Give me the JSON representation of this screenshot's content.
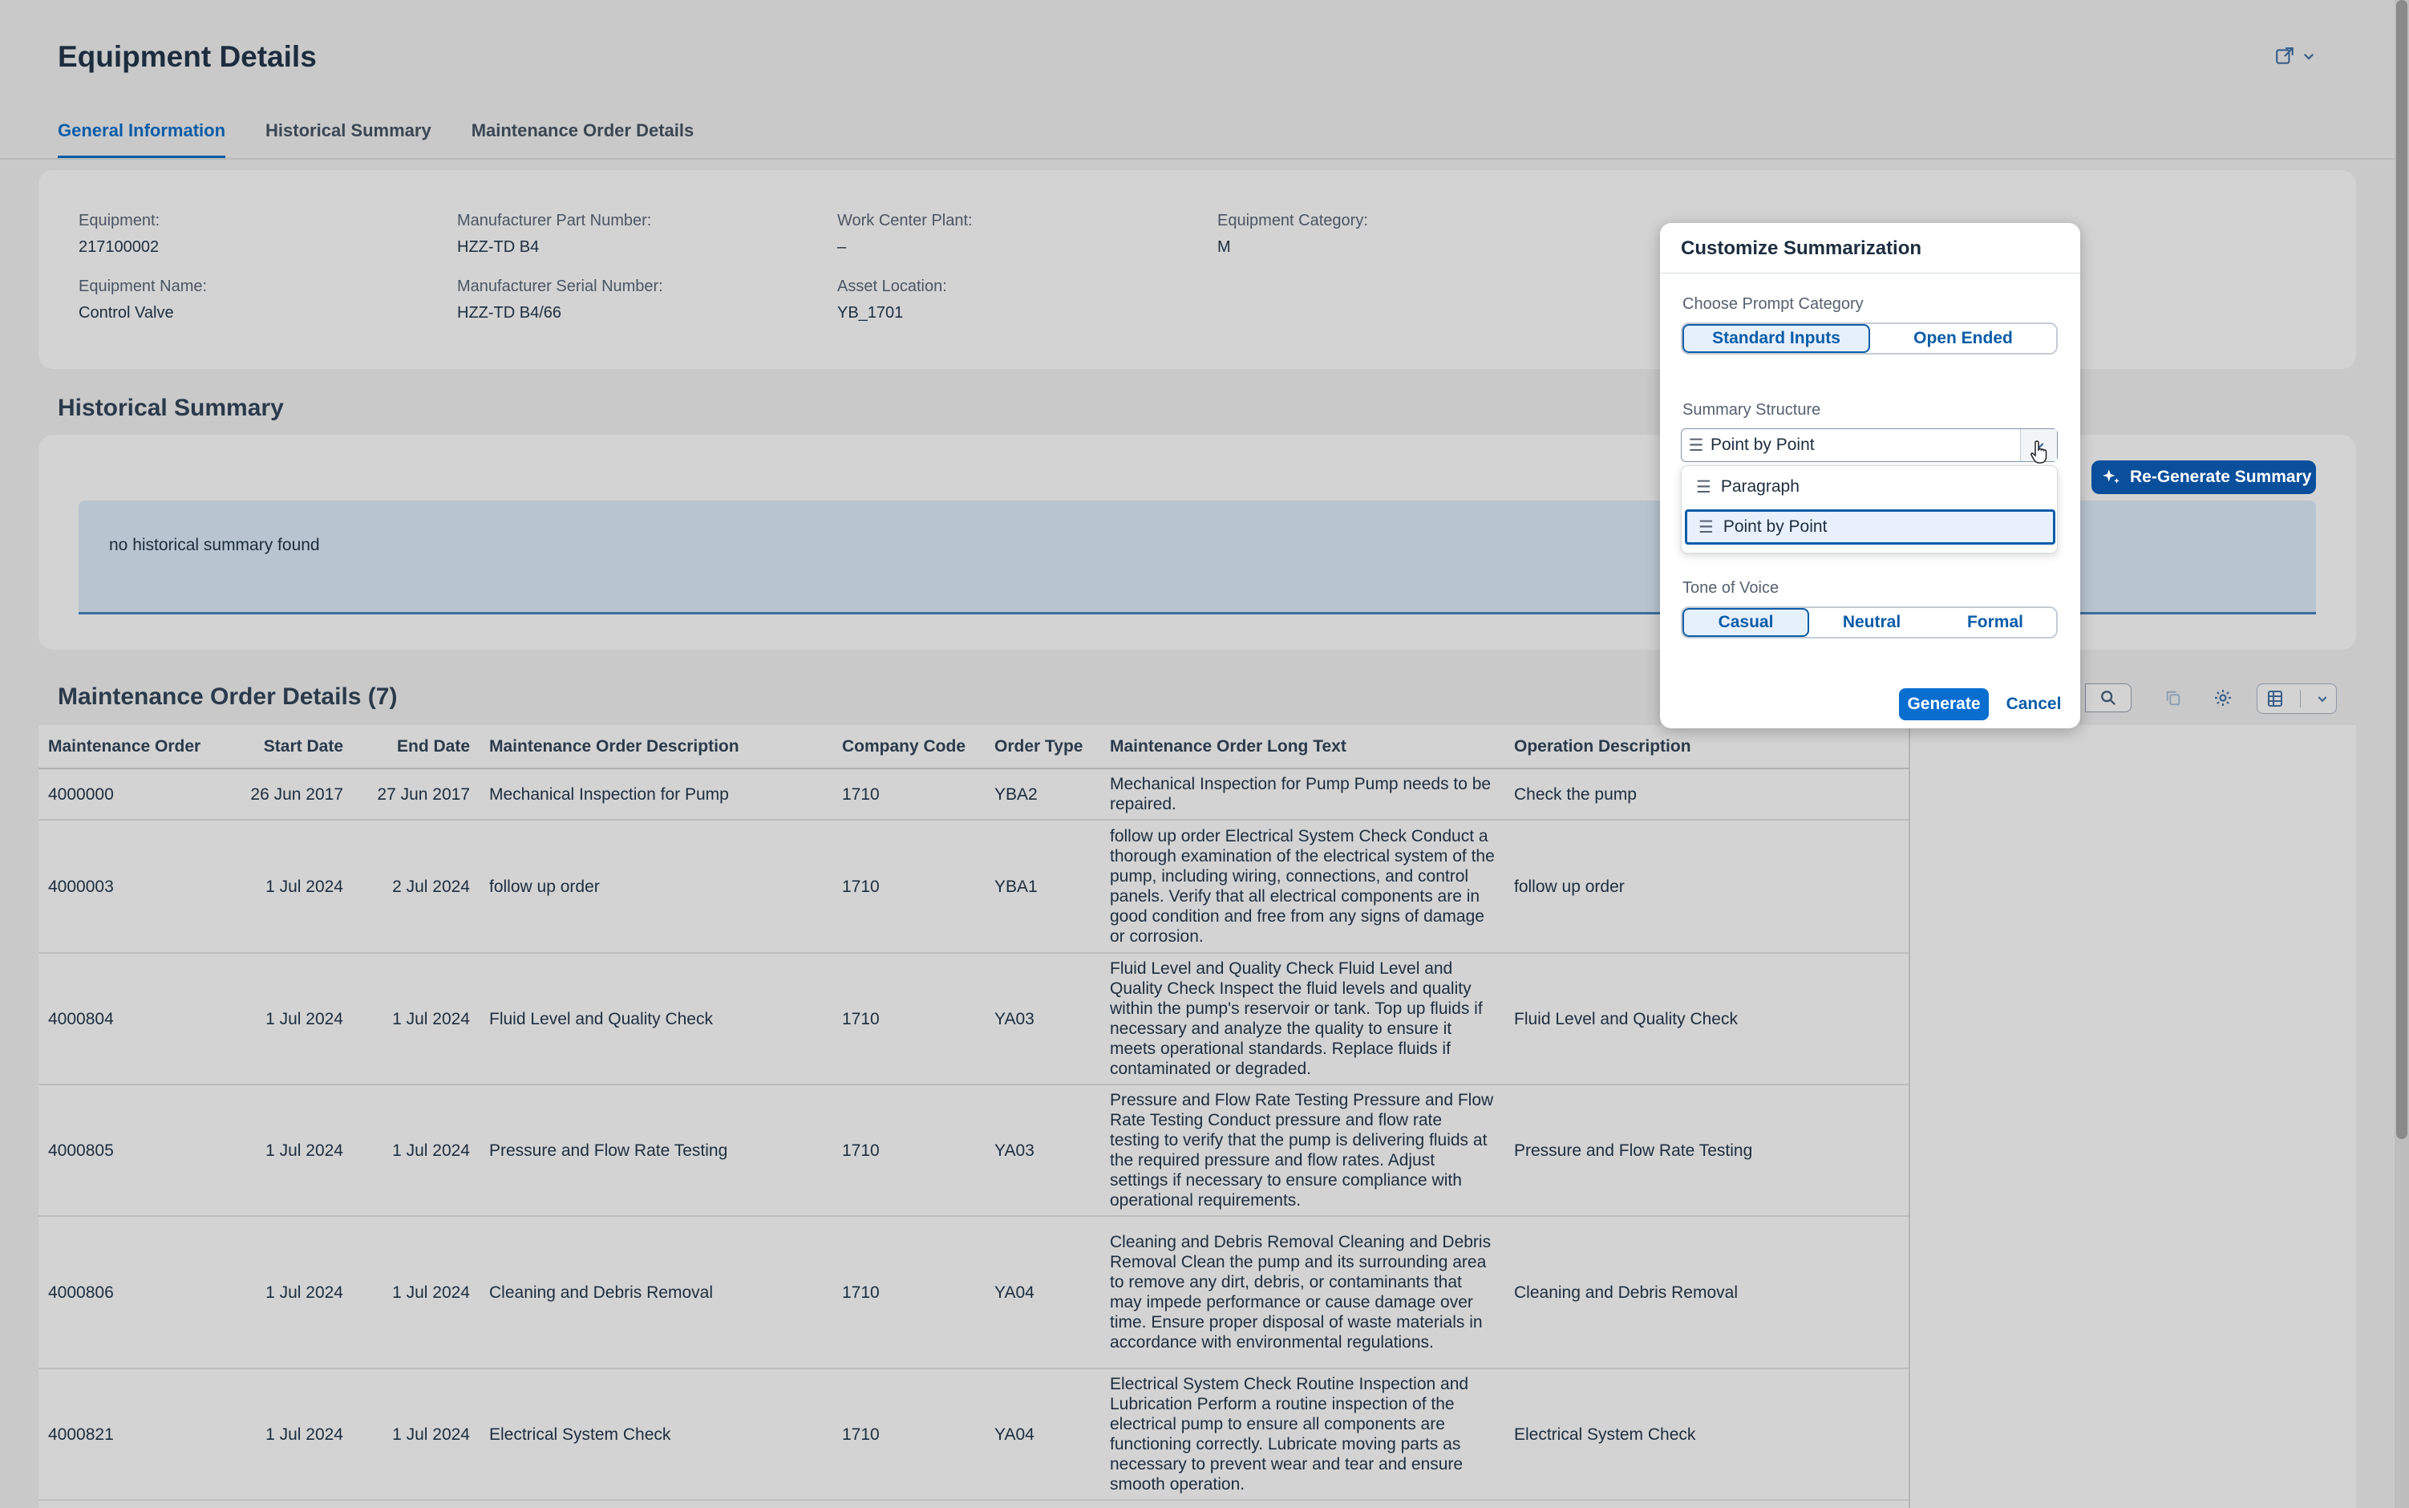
{
  "page": {
    "title": "Equipment Details"
  },
  "tabs": [
    {
      "label": "General Information",
      "active": true
    },
    {
      "label": "Historical Summary",
      "active": false
    },
    {
      "label": "Maintenance Order Details",
      "active": false
    }
  ],
  "general_info": {
    "equipment_label": "Equipment:",
    "equipment_value": "217100002",
    "equipment_name_label": "Equipment Name:",
    "equipment_name_value": "Control Valve",
    "mfr_part_label": "Manufacturer Part Number:",
    "mfr_part_value": "HZZ-TD B4",
    "mfr_serial_label": "Manufacturer Serial Number:",
    "mfr_serial_value": "HZZ-TD B4/66",
    "work_center_label": "Work Center Plant:",
    "work_center_value": "–",
    "asset_location_label": "Asset Location:",
    "asset_location_value": "YB_1701",
    "category_label": "Equipment Category:",
    "category_value": "M"
  },
  "historical_summary": {
    "title": "Historical Summary",
    "message": "no historical summary found",
    "regenerate_label": "Re-Generate Summary"
  },
  "maintenance_orders": {
    "title": "Maintenance Order Details (7)",
    "columns": [
      "Maintenance Order",
      "Start Date",
      "End Date",
      "Maintenance Order Description",
      "Company Code",
      "Order Type",
      "Maintenance Order Long Text",
      "Operation Description"
    ],
    "rows": [
      {
        "order": "4000000",
        "start": "26 Jun 2017",
        "end": "27 Jun 2017",
        "desc": "Mechanical Inspection for Pump",
        "company": "1710",
        "type": "YBA2",
        "long_text": "Mechanical Inspection for Pump Pump needs to be repaired.",
        "operation": "Check the pump"
      },
      {
        "order": "4000003",
        "start": "1 Jul 2024",
        "end": "2 Jul 2024",
        "desc": "follow up order",
        "company": "1710",
        "type": "YBA1",
        "long_text": "follow up order Electrical System Check Conduct a thorough examination of the electrical system of the pump, including wiring, connections, and control panels. Verify that all electrical components are in good condition and free from any signs of damage or corrosion.",
        "operation": "follow up order"
      },
      {
        "order": "4000804",
        "start": "1 Jul 2024",
        "end": "1 Jul 2024",
        "desc": "Fluid Level and Quality Check",
        "company": "1710",
        "type": "YA03",
        "long_text": "Fluid Level and Quality Check Fluid Level and Quality Check Inspect the fluid levels and quality within the pump's reservoir or tank. Top up fluids if necessary and analyze the quality to ensure it meets operational standards. Replace fluids if contaminated or degraded.",
        "operation": "Fluid Level and Quality Check"
      },
      {
        "order": "4000805",
        "start": "1 Jul 2024",
        "end": "1 Jul 2024",
        "desc": "Pressure and Flow Rate Testing",
        "company": "1710",
        "type": "YA03",
        "long_text": "Pressure and Flow Rate Testing Pressure and Flow Rate Testing Conduct pressure and flow rate testing to verify that the pump is delivering fluids at the required pressure and flow rates. Adjust settings if necessary to ensure compliance with operational requirements.",
        "operation": "Pressure and Flow Rate Testing"
      },
      {
        "order": "4000806",
        "start": "1 Jul 2024",
        "end": "1 Jul 2024",
        "desc": "Cleaning and Debris Removal",
        "company": "1710",
        "type": "YA04",
        "long_text": "Cleaning and Debris Removal Cleaning and Debris Removal Clean the pump and its surrounding area to remove any dirt, debris, or contaminants that may impede performance or cause damage over time. Ensure proper disposal of waste materials in accordance with environmental regulations.",
        "operation": "Cleaning and Debris Removal"
      },
      {
        "order": "4000821",
        "start": "1 Jul 2024",
        "end": "1 Jul 2024",
        "desc": "Electrical System Check",
        "company": "1710",
        "type": "YA04",
        "long_text": "Electrical System Check Routine Inspection and Lubrication Perform a routine inspection of the electrical pump to ensure all components are functioning correctly. Lubricate moving parts as necessary to prevent wear and tear and ensure smooth operation.",
        "operation": "Electrical System Check"
      }
    ]
  },
  "dialog": {
    "title": "Customize Summarization",
    "prompt_category_label": "Choose Prompt Category",
    "prompt_options": [
      "Standard Inputs",
      "Open Ended"
    ],
    "prompt_selected": "Standard Inputs",
    "structure_label": "Summary Structure",
    "structure_value": "Point by Point",
    "structure_options": [
      "Paragraph",
      "Point by Point"
    ],
    "tone_label": "Tone of Voice",
    "tone_options": [
      "Casual",
      "Neutral",
      "Formal"
    ],
    "tone_selected": "Casual",
    "generate_label": "Generate",
    "cancel_label": "Cancel"
  },
  "colors": {
    "accent": "#0a6ed1",
    "brand_dark": "#0a4f9c",
    "overlay_bg": "#c9c9c9"
  }
}
